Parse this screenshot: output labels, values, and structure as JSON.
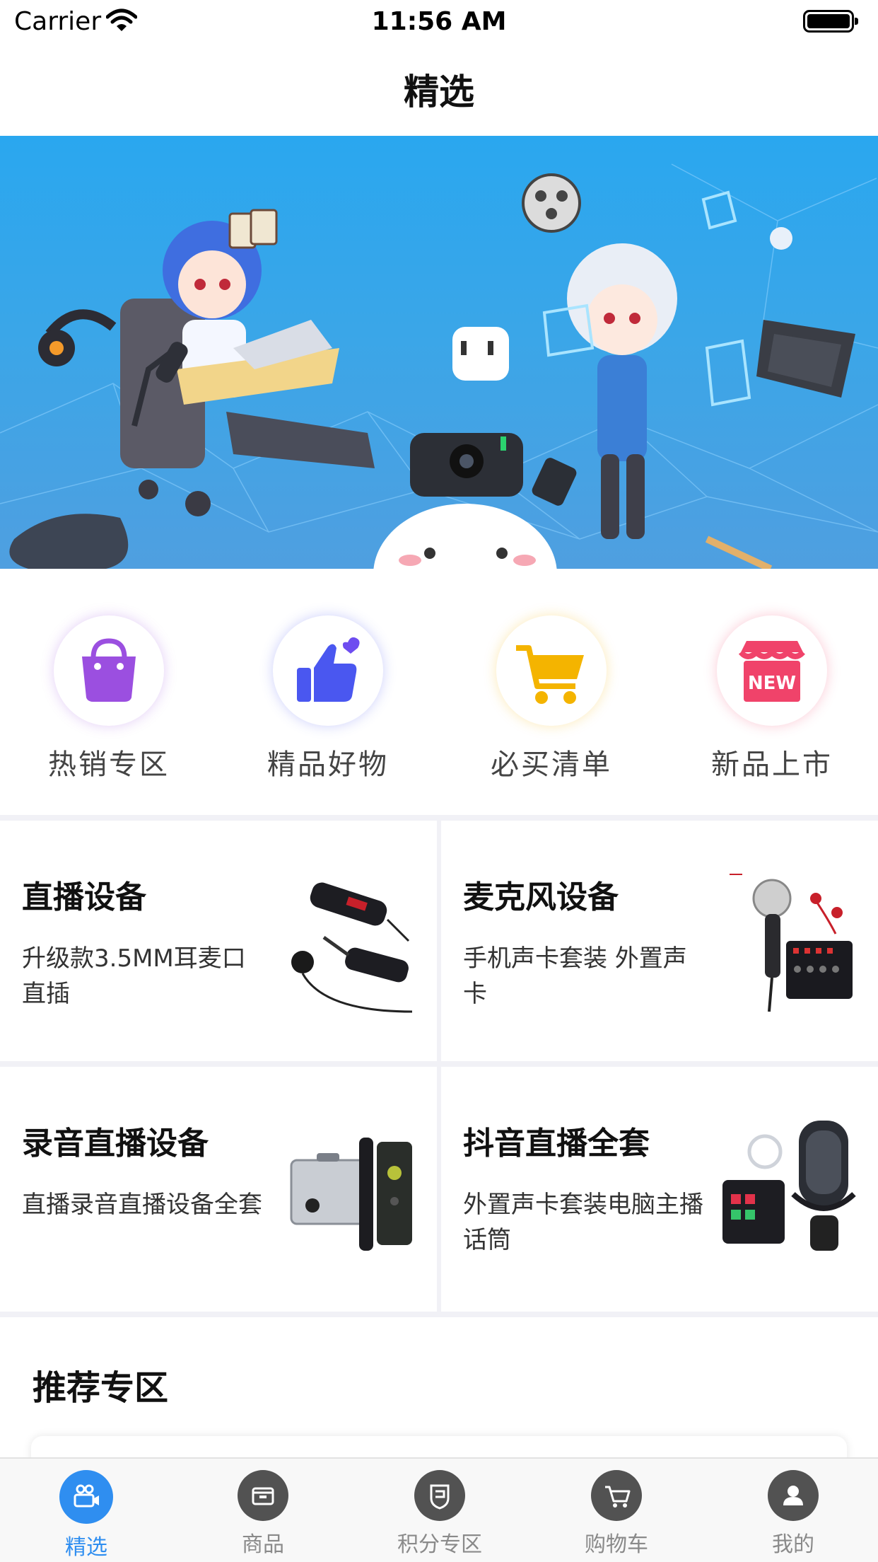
{
  "status_bar": {
    "carrier": "Carrier",
    "time": "11:56 AM"
  },
  "nav": {
    "title": "精选"
  },
  "quick_categories": [
    {
      "label": "热销专区",
      "icon": "shopping-bag-icon",
      "color": "#9b4fe0"
    },
    {
      "label": "精品好物",
      "icon": "thumbs-up-icon",
      "color": "#4a57f0"
    },
    {
      "label": "必买清单",
      "icon": "cart-icon",
      "color": "#f4b400"
    },
    {
      "label": "新品上市",
      "icon": "new-store-icon",
      "color": "#f0436a"
    }
  ],
  "products": [
    {
      "title": "直播设备",
      "desc": "升级款3.5MM耳麦口直插"
    },
    {
      "title": "麦克风设备",
      "desc": "手机声卡套装 外置声卡"
    },
    {
      "title": "录音直播设备",
      "desc": "直播录音直播设备全套"
    },
    {
      "title": "抖音直播全套",
      "desc": "外置声卡套装电脑主播话筒"
    }
  ],
  "recommend": {
    "title": "推荐专区"
  },
  "tabs": [
    {
      "label": "精选",
      "icon": "camera-icon",
      "active": true
    },
    {
      "label": "商品",
      "icon": "box-icon",
      "active": false
    },
    {
      "label": "积分专区",
      "icon": "shield-icon",
      "active": false
    },
    {
      "label": "购物车",
      "icon": "cart-icon",
      "active": false
    },
    {
      "label": "我的",
      "icon": "user-icon",
      "active": false
    }
  ],
  "colors": {
    "accent": "#2f8ef0",
    "banner": "#2aa7ef",
    "separator": "#f1f1f6"
  }
}
